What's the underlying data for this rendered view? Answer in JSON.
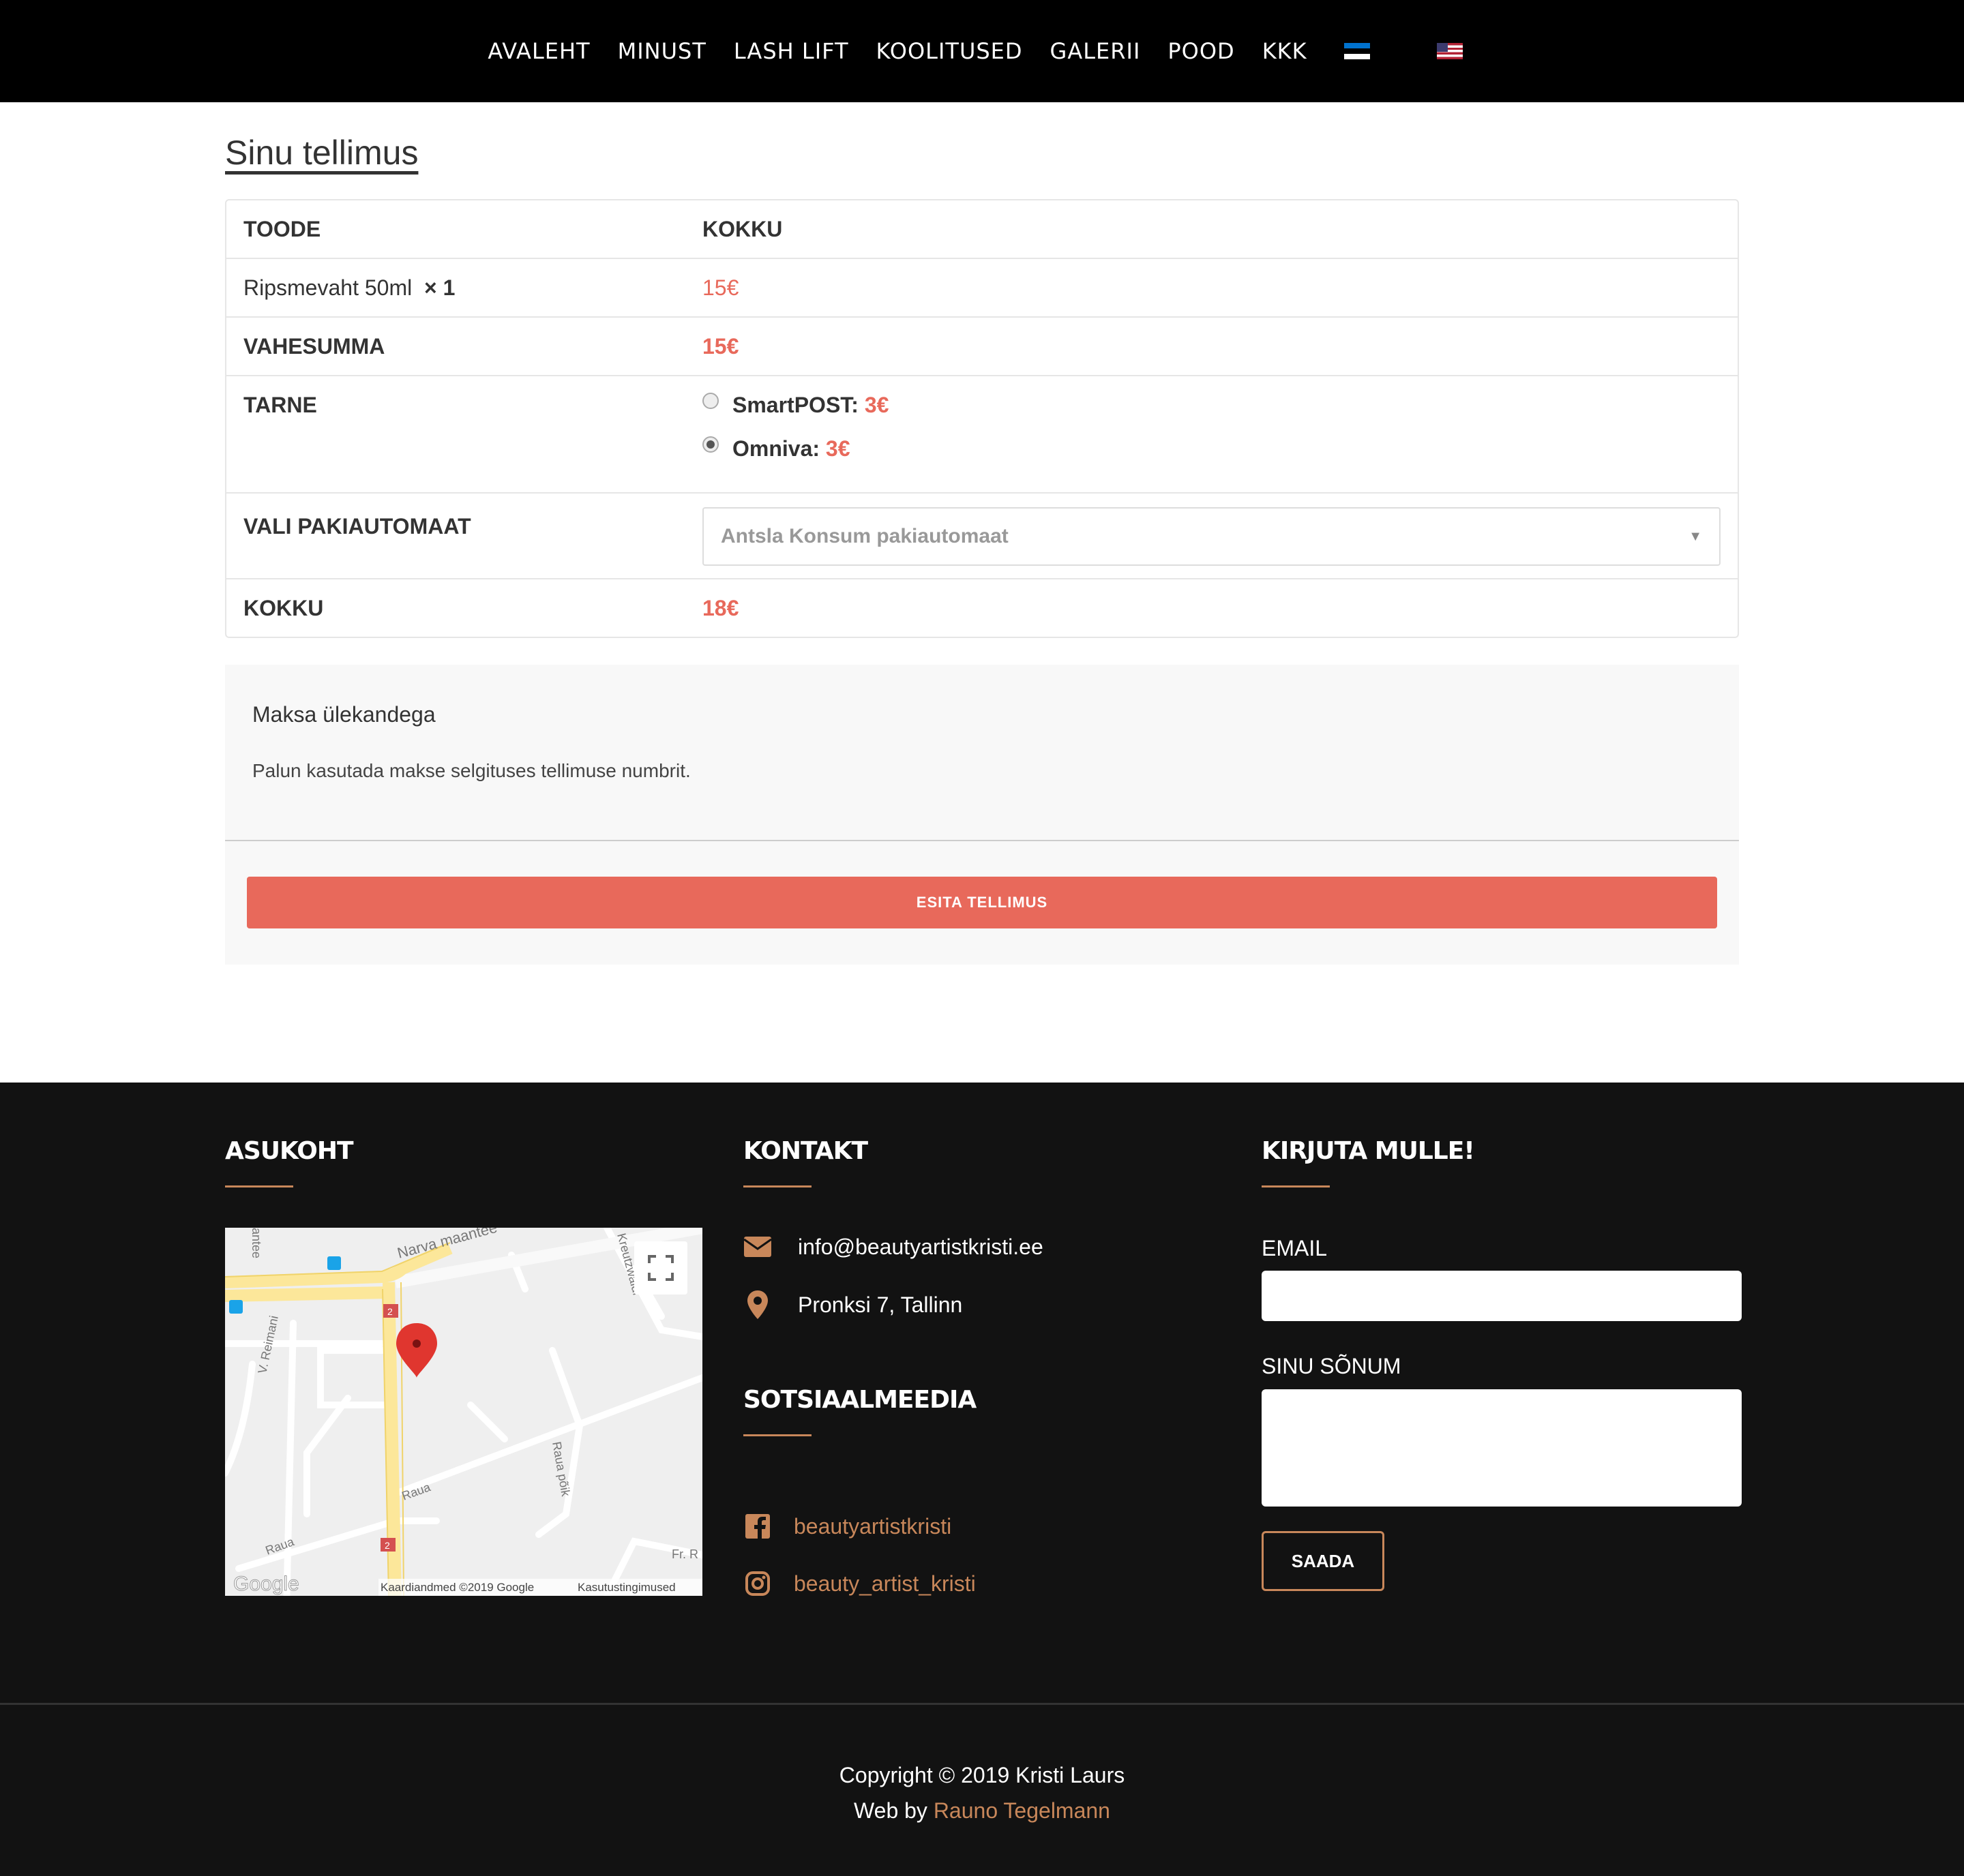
{
  "nav": {
    "items": [
      "AVALEHT",
      "MINUST",
      "LASH LIFT",
      "KOOLITUSED",
      "GALERII",
      "POOD",
      "KKK"
    ],
    "flags": [
      "estonia-flag-icon",
      "usa-flag-icon"
    ]
  },
  "order": {
    "title": "Sinu tellimus",
    "col_product": "TOODE",
    "col_total": "KOKKU",
    "product_name": "Ripsmevaht 50ml",
    "product_qty": "× 1",
    "product_price": "15€",
    "subtotal_label": "VAHESUMMA",
    "subtotal_value": "15€",
    "shipping_label": "TARNE",
    "shipping_options": [
      {
        "label": "SmartPOST:",
        "price": "3€",
        "selected": false
      },
      {
        "label": "Omniva:",
        "price": "3€",
        "selected": true
      }
    ],
    "parcel_label": "VALI PAKIAUTOMAAT",
    "parcel_selected": "Antsla Konsum pakiautomaat",
    "total_label": "KOKKU",
    "total_value": "18€"
  },
  "payment": {
    "method": "Maksa ülekandega",
    "description": "Palun kasutada makse selgituses tellimuse numbrit.",
    "submit_label": "ESITA TELLIMUS"
  },
  "footer": {
    "location_heading": "ASUKOHT",
    "contact_heading": "KONTAKT",
    "email": "info@beautyartistkristi.ee",
    "address": "Pronksi 7, Tallinn",
    "social_heading": "SOTSIAALMEEDIA",
    "facebook": "beautyartistkristi",
    "instagram": "beauty_artist_kristi",
    "form_heading": "KIRJUTA MULLE!",
    "email_label": "EMAIL",
    "message_label": "SINU SÕNUM",
    "send_label": "SAADA",
    "map_labels": {
      "narva": "Narva maantee",
      "reimani": "V. Reimani",
      "raua": "Raua",
      "raua_poik": "Raua põik",
      "kreutzwaldi": "Kreutzwaldi",
      "fr_r": "Fr. R",
      "tartu": "antee",
      "raua2": "Raua",
      "route": "2",
      "google": "Google",
      "map_data": "Kaardiandmed ©2019 Google",
      "terms": "Kasutustingimused"
    },
    "copyright": "Copyright © 2019 Kristi Laurs",
    "web_by_prefix": "Web by",
    "web_by_name": "Rauno Tegelmann"
  },
  "colors": {
    "accent": "#e8695b",
    "footer_accent": "#c8875a",
    "footer_bg": "#121212"
  }
}
